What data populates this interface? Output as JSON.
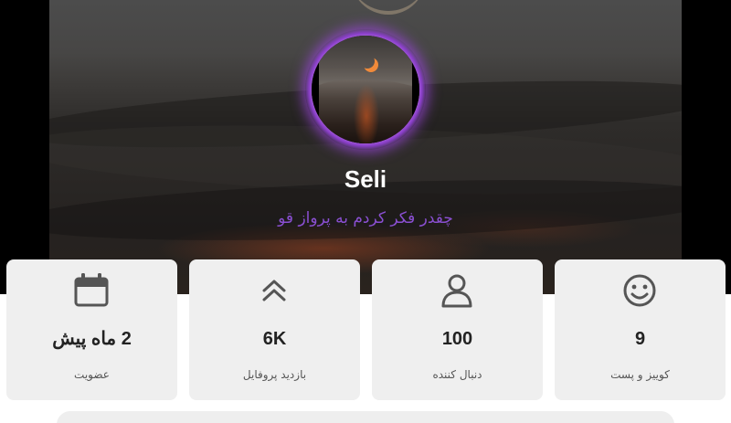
{
  "profile": {
    "name": "Seli",
    "bio": "چقدر فکر کردم به پرواز قو"
  },
  "stats": [
    {
      "icon": "calendar-icon",
      "value": "2 ماه پیش",
      "label": "عضویت"
    },
    {
      "icon": "double-chevron-up-icon",
      "value": "6K",
      "label": "بازدید پروفایل"
    },
    {
      "icon": "user-icon",
      "value": "100",
      "label": "دنبال کننده"
    },
    {
      "icon": "smiley-icon",
      "value": "9",
      "label": "کوییز و پست"
    }
  ],
  "colors": {
    "accent": "#8a4fd1",
    "avatar_glow": "#9b46dc",
    "card_bg": "#efefef"
  }
}
